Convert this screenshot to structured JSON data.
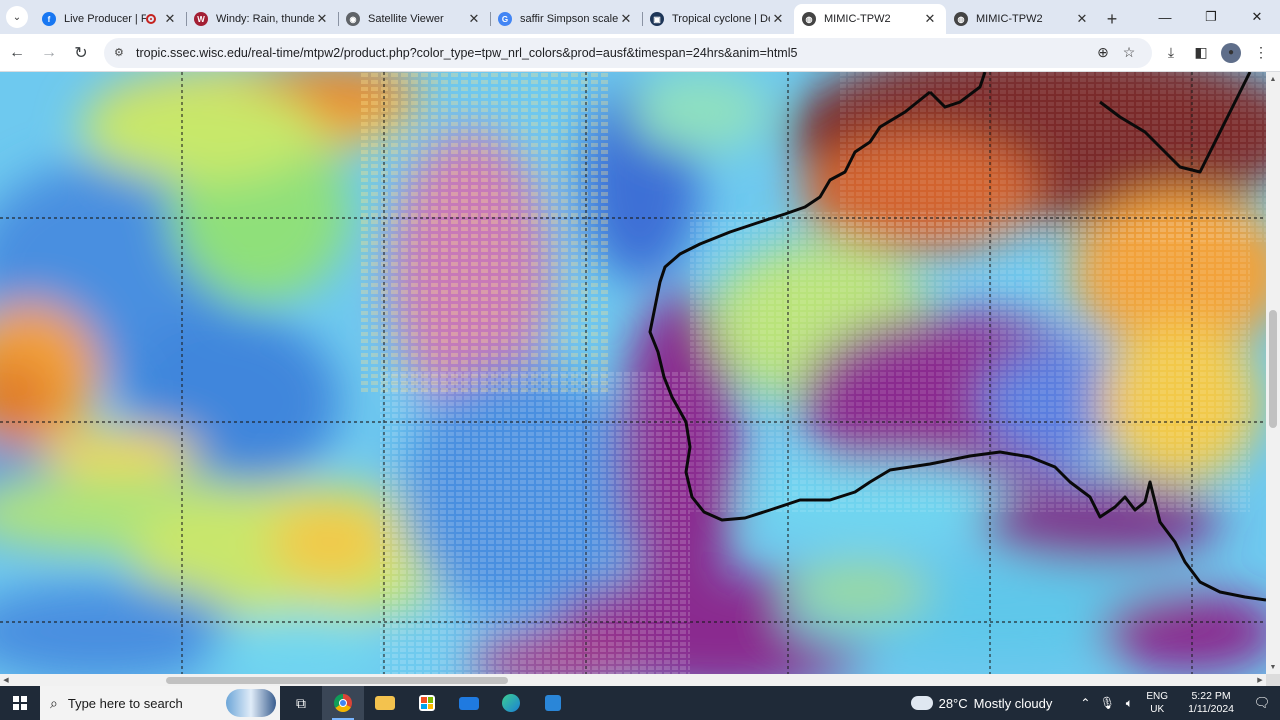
{
  "browser": {
    "tabs": [
      {
        "title": "Live Producer | Fa",
        "favicon": "facebook-icon",
        "color": "#1877f2",
        "glyph": "f"
      },
      {
        "title": "Windy: Rain, thunder",
        "favicon": "windy-icon",
        "color": "#a31f34",
        "glyph": "W"
      },
      {
        "title": "Satellite Viewer",
        "favicon": "globe-icon",
        "color": "#5f6368",
        "glyph": "◉"
      },
      {
        "title": "saffir Simpson scale",
        "favicon": "google-icon",
        "color": "#4285f4",
        "glyph": "G"
      },
      {
        "title": "Tropical cyclone | Def",
        "favicon": "bom-icon",
        "color": "#1d3557",
        "glyph": "▣"
      },
      {
        "title": "MIMIC-TPW2",
        "favicon": "ssec-icon",
        "color": "#444",
        "glyph": "◍"
      },
      {
        "title": "MIMIC-TPW2",
        "favicon": "ssec-icon",
        "color": "#444",
        "glyph": "◍"
      }
    ],
    "active_tab": 5,
    "url": "tropic.ssec.wisc.edu/real-time/mtpw2/product.php?color_type=tpw_nrl_colors&prod=ausf&timespan=24hrs&anim=html5"
  },
  "map": {
    "description_colors": {
      "dry_blue": "#4a8fe0",
      "cyan": "#6fd6f0",
      "green": "#8fe07a",
      "yellow": "#f2e05a",
      "orange": "#f2a23a",
      "magenta": "#8a2b8f",
      "maroon": "#7a2a2a",
      "pink": "#d678c0"
    }
  },
  "taskbar": {
    "search_placeholder": "Type here to search",
    "weather_temp": "28°C",
    "weather_text": "Mostly cloudy",
    "lang_top": "ENG",
    "lang_bottom": "UK",
    "time": "5:22 PM",
    "date": "1/11/2024"
  }
}
